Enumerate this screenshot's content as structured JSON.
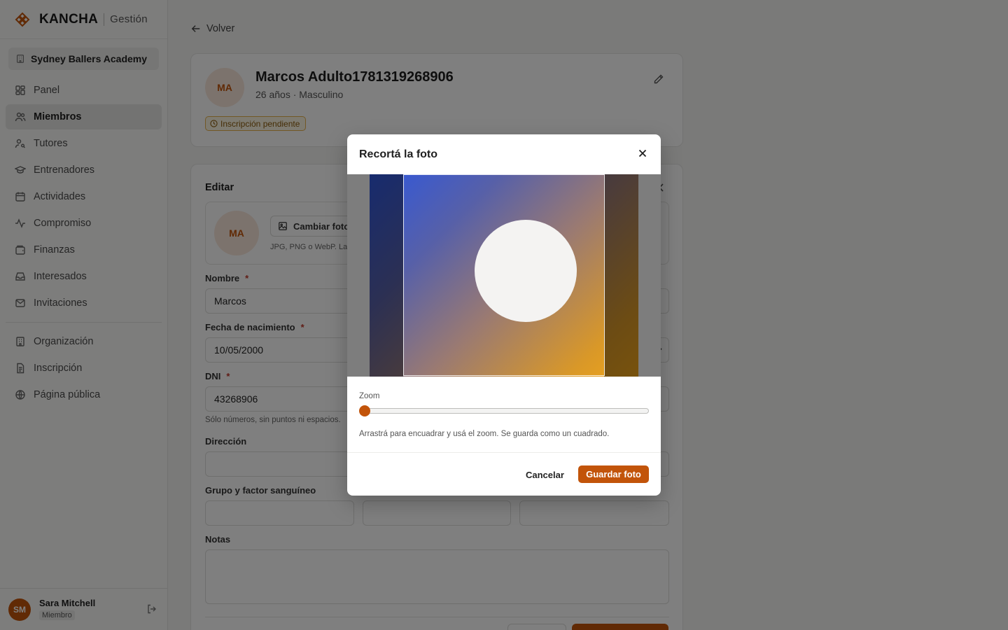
{
  "brand": {
    "name": "KANCHA",
    "subtitle": "Gestión"
  },
  "sidebar": {
    "organization": "Sydney Ballers Academy",
    "items": [
      {
        "label": "Panel",
        "icon": "dashboard-icon"
      },
      {
        "label": "Miembros",
        "icon": "users-icon",
        "active": true
      },
      {
        "label": "Tutores",
        "icon": "user-key-icon"
      },
      {
        "label": "Entrenadores",
        "icon": "graduation-cap-icon"
      },
      {
        "label": "Actividades",
        "icon": "calendar-icon"
      },
      {
        "label": "Compromiso",
        "icon": "activity-icon"
      },
      {
        "label": "Finanzas",
        "icon": "wallet-icon"
      },
      {
        "label": "Interesados",
        "icon": "inbox-icon"
      },
      {
        "label": "Invitaciones",
        "icon": "mail-icon"
      }
    ],
    "secondary_items": [
      {
        "label": "Organización",
        "icon": "building-icon"
      },
      {
        "label": "Inscripción",
        "icon": "document-icon"
      },
      {
        "label": "Página pública",
        "icon": "globe-icon"
      }
    ],
    "user": {
      "initials": "SM",
      "name": "Sara Mitchell",
      "role": "Miembro"
    }
  },
  "main": {
    "back_label": "Volver",
    "profile": {
      "initials": "MA",
      "name": "Marcos Adulto1781319268906",
      "meta": "26 años · Masculino",
      "status": "Inscripción pendiente"
    },
    "edit": {
      "title": "Editar",
      "avatar_initials": "MA",
      "change_photo_label": "Cambiar foto",
      "photo_hint": "JPG, PNG o WebP. La",
      "fields": {
        "nombre_label": "Nombre",
        "nombre_value": "Marcos",
        "fecha_label": "Fecha de nacimiento",
        "fecha_value": "10/05/2000",
        "dni_label": "DNI",
        "dni_value": "43268906",
        "dni_hint": "Sólo números, sin puntos ni espacios.",
        "direccion_label": "Dirección",
        "sangre_label": "Grupo y factor sanguíneo",
        "notas_label": "Notas",
        "required_mark": "*"
      }
    }
  },
  "modal": {
    "title": "Recortá la foto",
    "zoom_label": "Zoom",
    "zoom_value": 0,
    "hint": "Arrastrá para encuadrar y usá el zoom. Se guarda como un cuadrado.",
    "cancel_label": "Cancelar",
    "save_label": "Guardar foto"
  },
  "colors": {
    "accent": "#c2540a"
  }
}
